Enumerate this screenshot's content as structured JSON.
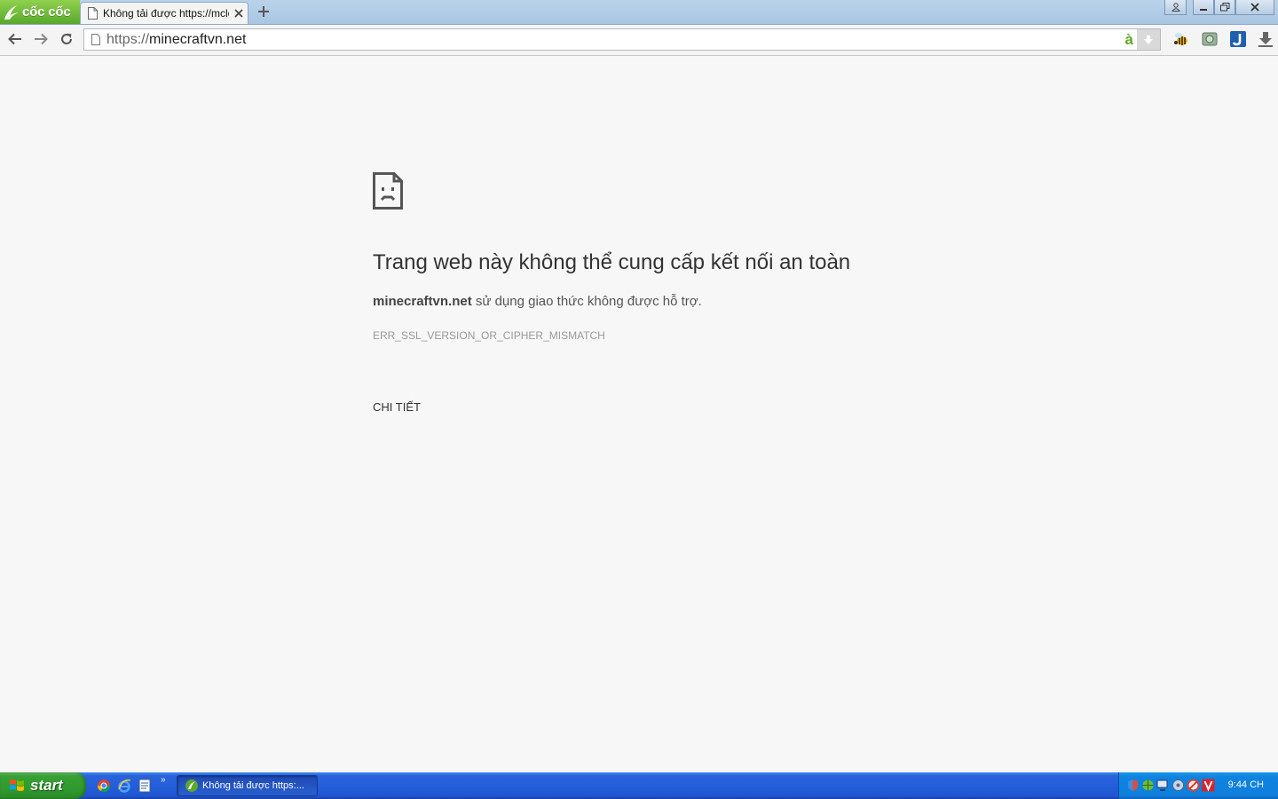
{
  "browser": {
    "logo_text": "cốc cốc",
    "tab": {
      "title": "Không tải được https://mclean"
    },
    "omnibox": {
      "scheme": "https://",
      "host": "minecraftvn.net",
      "assist_letter": "à"
    },
    "icons": {
      "logo": "coccoc-logo-icon",
      "page": "page-icon",
      "close": "close-icon",
      "new_tab": "plus-icon",
      "back": "back-arrow-icon",
      "forward": "forward-arrow-icon",
      "reload": "reload-icon",
      "download": "download-icon",
      "profile": "person-icon",
      "minimize": "minimize-icon",
      "restore": "restore-icon",
      "close_window": "close-window-icon"
    },
    "extensions": [
      "bee-icon",
      "image-extension-icon",
      "j-extension-icon",
      "download-icon"
    ]
  },
  "error_page": {
    "heading": "Trang web này không thể cung cấp kết nối an toàn",
    "domain": "minecraftvn.net",
    "description": "sử dụng giao thức không được hỗ trợ.",
    "error_code": "ERR_SSL_VERSION_OR_CIPHER_MISMATCH",
    "details_label": "CHI TIẾT",
    "icon": "sad-page-icon"
  },
  "taskbar": {
    "start_label": "start",
    "quick_launch": [
      "chrome-icon",
      "ie-icon",
      "document-icon"
    ],
    "more_label": "»",
    "task": {
      "label": "Không tải được https:..."
    },
    "tray_icons": [
      "shield-icon",
      "network-icon",
      "monitor-icon",
      "speaker-icon",
      "antivirus-icon",
      "v-icon"
    ],
    "clock": "9:44 CH"
  },
  "colors": {
    "brand_green": "#5aa82c",
    "page_bg": "#f7f7f7",
    "taskbar_blue": "#245edb",
    "start_green": "#37a035"
  }
}
